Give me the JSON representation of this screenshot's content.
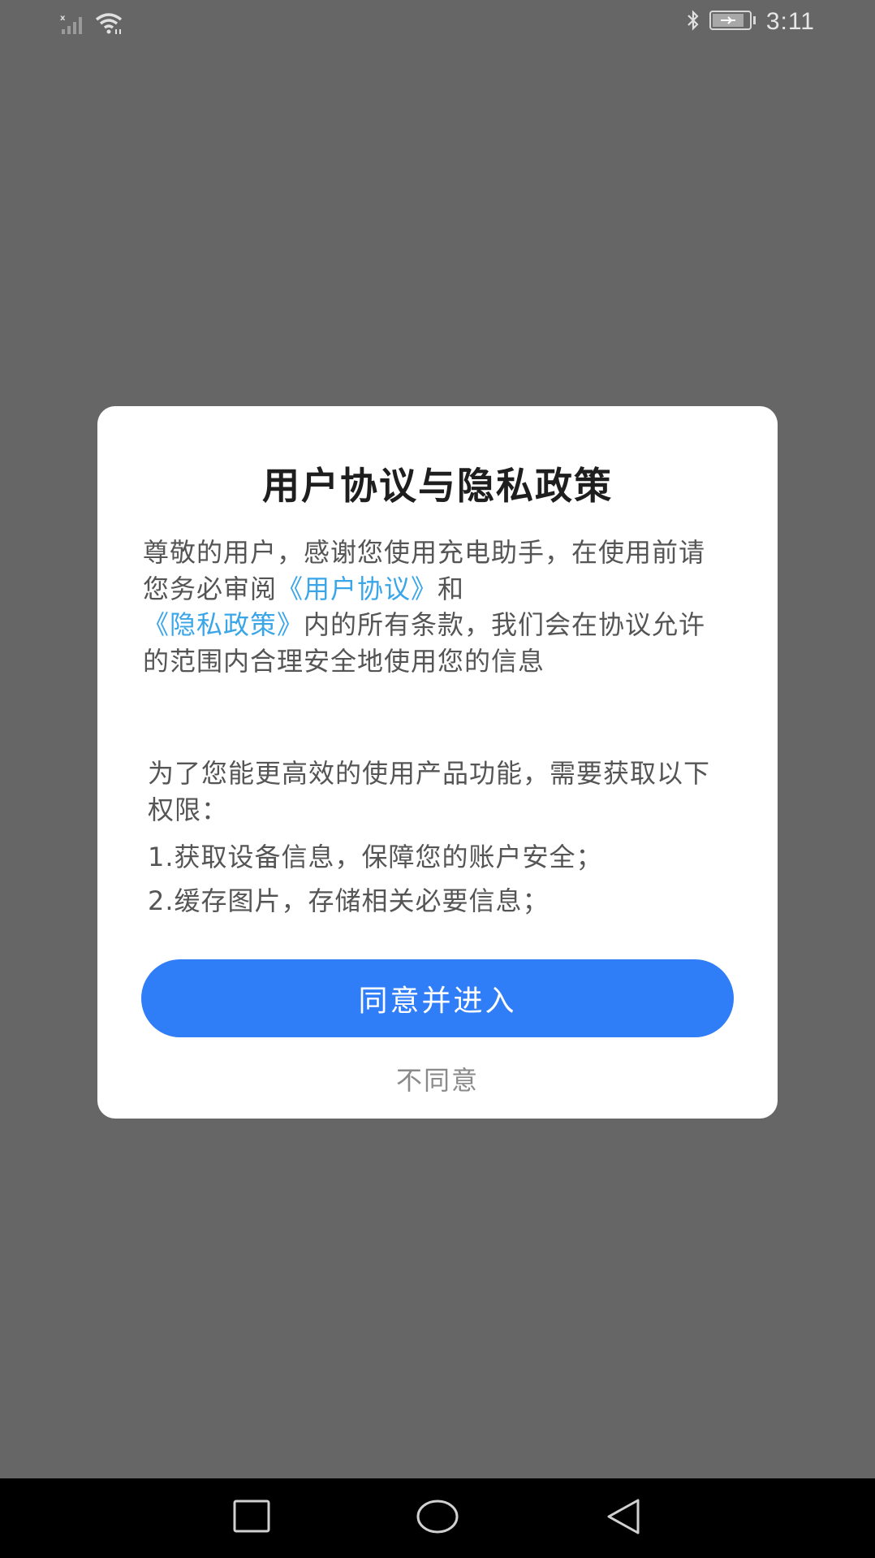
{
  "status_bar": {
    "time": "3:11",
    "icons": [
      "signal-no-sim-icon",
      "wifi-icon",
      "bluetooth-icon",
      "battery-charging-icon"
    ]
  },
  "dialog": {
    "title": "用户协议与隐私政策",
    "intro_part1": "尊敬的用户，感谢您使用充电助手，在使用前请您务必审阅",
    "user_agreement_link": "《用户协议》",
    "intro_part2": "和",
    "privacy_policy_link": "《隐私政策》",
    "intro_part3": "内的所有条款，我们会在协议允许的范围内合理安全地使用您的信息",
    "permissions_intro": "为了您能更高效的使用产品功能，需要获取以下权限：",
    "permissions": [
      "1.获取设备信息，保障您的账户安全；",
      "2.缓存图片，存储相关必要信息；"
    ],
    "agree_button": "同意并进入",
    "disagree_button": "不同意"
  },
  "colors": {
    "overlay": "#666666",
    "primary_button": "#307df8",
    "link": "#3aa6e8"
  },
  "nav_bar": {
    "buttons": [
      "recents-icon",
      "home-icon",
      "back-icon"
    ]
  }
}
